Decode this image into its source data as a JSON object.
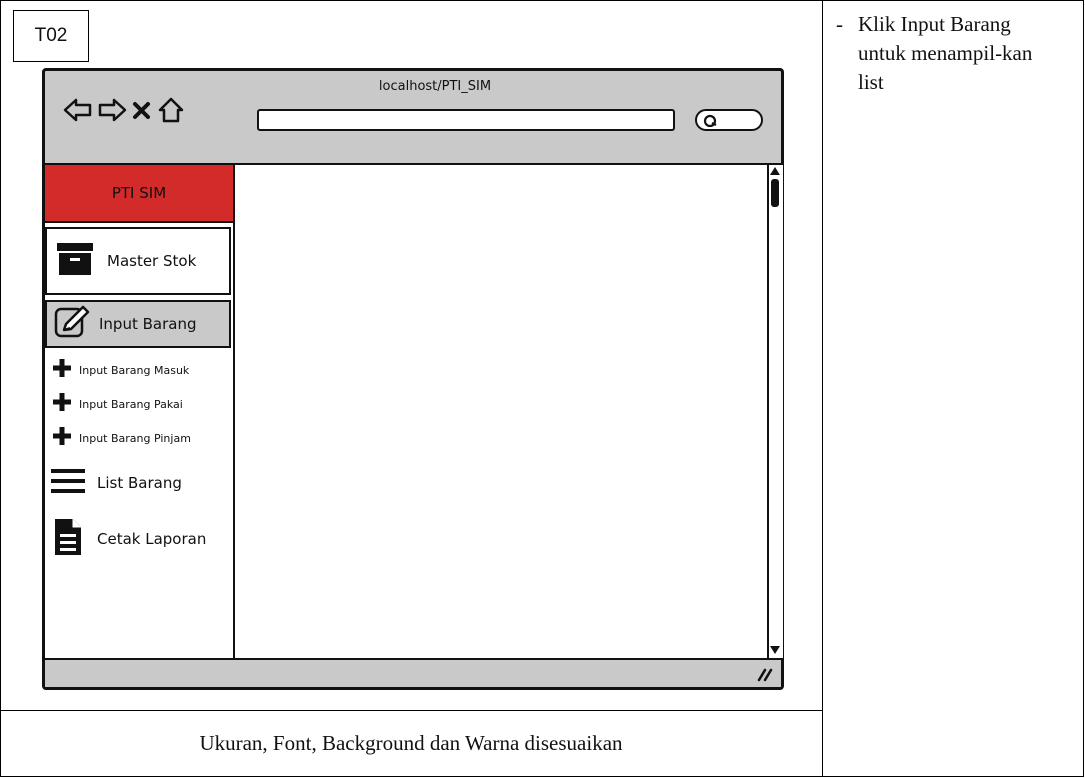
{
  "task_code": "T02",
  "browser": {
    "url": "localhost/PTI_SIM",
    "nav_icons": [
      "back-arrow-icon",
      "forward-arrow-icon",
      "close-icon",
      "home-icon",
      "search-icon"
    ]
  },
  "sidebar": {
    "brand": "PTI SIM",
    "brand_color": "#d32a2a",
    "items": [
      {
        "label": "Master Stok",
        "icon": "archive-box-icon"
      },
      {
        "label": "Input Barang",
        "icon": "edit-pencil-icon",
        "active": true
      },
      {
        "label": "Input Barang Masuk",
        "icon": "plus-icon"
      },
      {
        "label": "Input Barang Pakai",
        "icon": "plus-icon"
      },
      {
        "label": "Input Barang Pinjam",
        "icon": "plus-icon"
      },
      {
        "label": "List Barang",
        "icon": "list-lines-icon"
      },
      {
        "label": "Cetak Laporan",
        "icon": "document-icon"
      }
    ]
  },
  "note": {
    "bullet": "-",
    "text": "Klik Input Barang untuk menampil-kan list"
  },
  "caption": "Ukuran, Font, Background dan Warna disesuaikan",
  "colors": {
    "chrome": "#c9c9c9",
    "active_item": "#c9c9c9"
  }
}
